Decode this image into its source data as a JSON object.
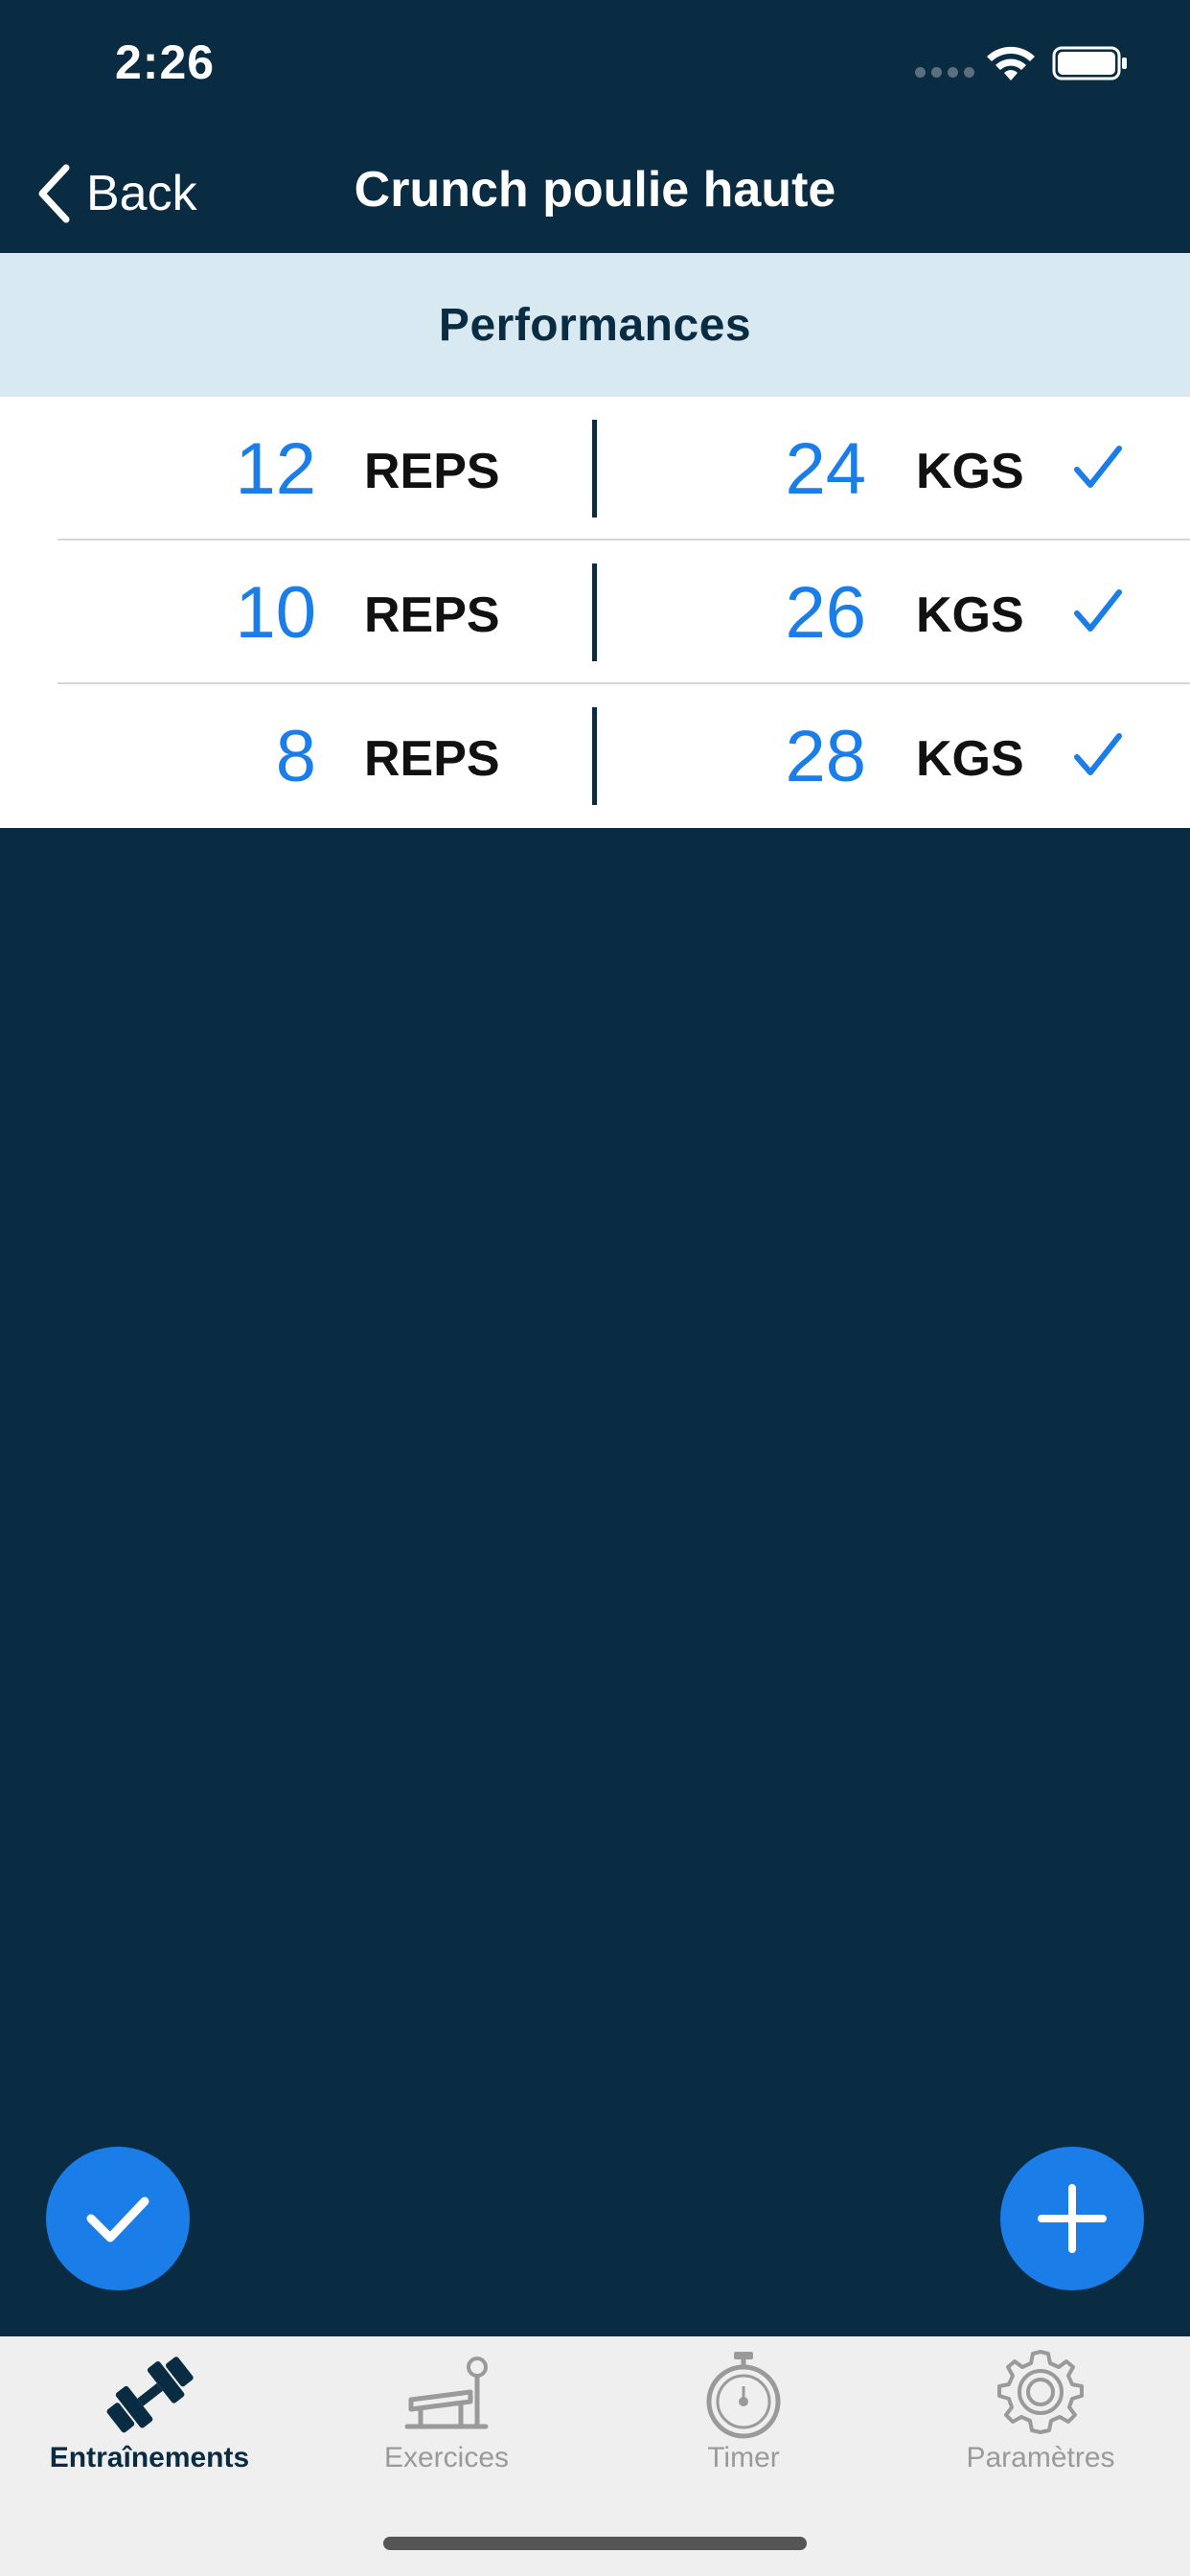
{
  "status_bar": {
    "time": "2:26"
  },
  "nav": {
    "back_label": "Back",
    "title": "Crunch poulie haute"
  },
  "section": {
    "title": "Performances"
  },
  "sets": [
    {
      "reps": "12",
      "reps_unit": "REPS",
      "weight": "24",
      "weight_unit": "KGS",
      "done": true
    },
    {
      "reps": "10",
      "reps_unit": "REPS",
      "weight": "26",
      "weight_unit": "KGS",
      "done": true
    },
    {
      "reps": "8",
      "reps_unit": "REPS",
      "weight": "28",
      "weight_unit": "KGS",
      "done": true
    }
  ],
  "tabs": [
    {
      "label": "Entraînements",
      "icon": "dumbbell-icon",
      "active": true
    },
    {
      "label": "Exercices",
      "icon": "bench-icon",
      "active": false
    },
    {
      "label": "Timer",
      "icon": "stopwatch-icon",
      "active": false
    },
    {
      "label": "Paramètres",
      "icon": "gear-icon",
      "active": false
    }
  ],
  "colors": {
    "background": "#0a2c42",
    "accent": "#1a7de8",
    "section_header": "#d9e9f1",
    "tab_bar": "#efefef"
  }
}
